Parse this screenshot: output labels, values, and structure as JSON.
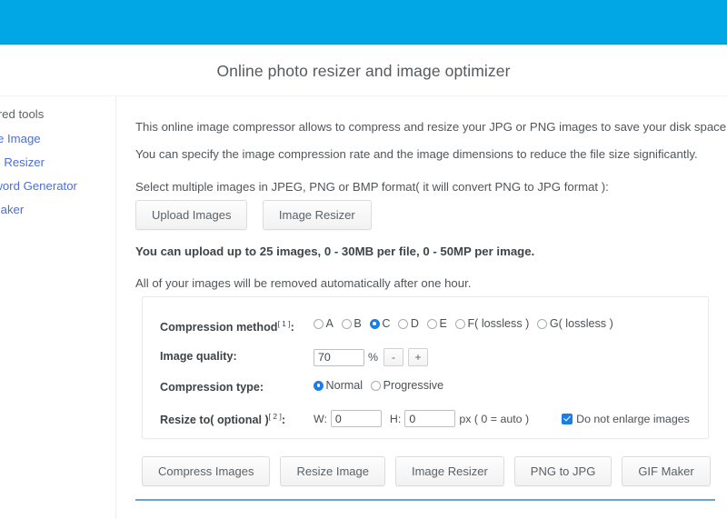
{
  "header": {
    "brand_bar_color": "#01a7e4"
  },
  "page_title": "Online photo resizer and image optimizer",
  "sidebar": {
    "heading": "Featured tools",
    "link_color": "#4d6fd0",
    "items": [
      {
        "label": "Resize Image"
      },
      {
        "label": "Image Resizer"
      },
      {
        "label": "Password Generator"
      },
      {
        "label": "GIF Maker"
      }
    ]
  },
  "main": {
    "intro_1": "This online image compressor allows to compress and resize your JPG or PNG images to save your disk space.",
    "intro_2": "You can specify the image compression rate and the image dimensions to reduce the file size significantly.",
    "intro_3": "Select multiple images in JPEG, PNG or BMP format( it will convert PNG to JPG format ):",
    "upload_buttons": [
      {
        "label": "Upload Images"
      },
      {
        "label": "Image Resizer"
      }
    ],
    "limit_note": "You can upload up to 25 images, 0 - 30MB per file, 0 - 50MP per image.",
    "removal_note": "All of your images will be removed automatically after one hour."
  },
  "options": {
    "compression_method": {
      "label": "Compression method",
      "footnote": "[ 1 ]",
      "selected": "C",
      "choices": [
        {
          "value": "A",
          "label": "A",
          "selected": false
        },
        {
          "value": "B",
          "label": "B",
          "selected": false
        },
        {
          "value": "C",
          "label": "C",
          "selected": true
        },
        {
          "value": "D",
          "label": "D",
          "selected": false
        },
        {
          "value": "E",
          "label": "E",
          "selected": false
        },
        {
          "value": "F",
          "label": "F( lossless )",
          "selected": false
        },
        {
          "value": "G",
          "label": "G( lossless )",
          "selected": false
        }
      ]
    },
    "image_quality": {
      "label": "Image quality:",
      "value": "70",
      "unit": "%",
      "decrement_label": "-",
      "increment_label": "+"
    },
    "compression_type": {
      "label": "Compression type:",
      "selected": "Normal",
      "choices": [
        {
          "value": "Normal",
          "label": "Normal",
          "selected": true
        },
        {
          "value": "Progressive",
          "label": "Progressive",
          "selected": false
        }
      ]
    },
    "resize_to": {
      "label": "Resize to( optional )",
      "footnote": "[ 2 ]",
      "width_label": "W:",
      "width_value": "0",
      "height_label": "H:",
      "height_value": "0",
      "unit_note": "px ( 0 = auto )",
      "no_enlarge_label": "Do not enlarge images",
      "no_enlarge_checked": true
    },
    "accent_color": "#1a7ee8"
  },
  "actions": [
    {
      "label": "Compress Images"
    },
    {
      "label": "Resize Image"
    },
    {
      "label": "Image Resizer"
    },
    {
      "label": "PNG to JPG"
    },
    {
      "label": "GIF Maker"
    }
  ]
}
